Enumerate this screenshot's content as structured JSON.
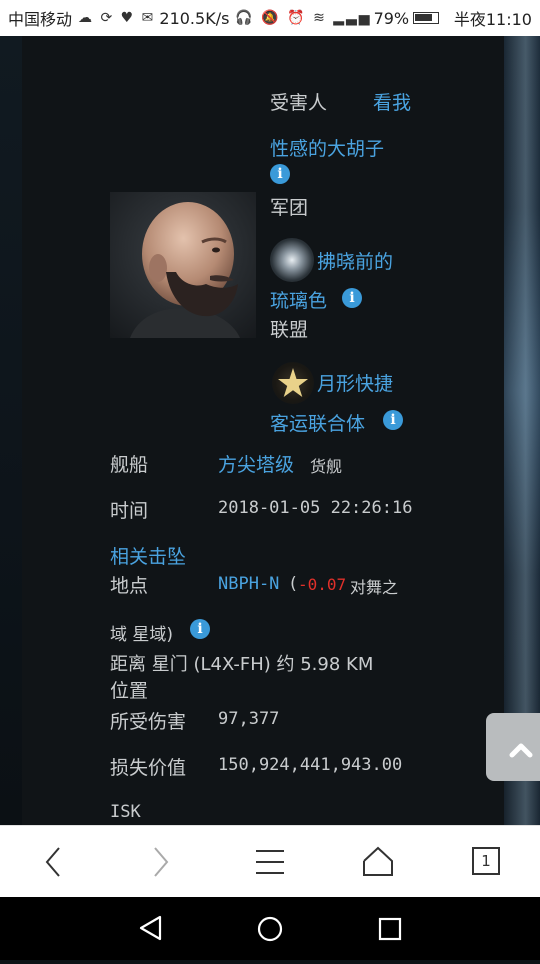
{
  "status_bar": {
    "carrier": "中国移动",
    "speed": "210.5K/s",
    "battery": "79%",
    "time": "半夜11:10",
    "icons": [
      "cloud-icon",
      "sync-icon",
      "heart-icon",
      "chat-icon",
      "headset-icon",
      "mute-icon",
      "alarm-icon",
      "wifi-icon",
      "4g-signal-icon",
      "battery-icon"
    ]
  },
  "victim": {
    "label": "受害人",
    "look_link": "看我",
    "name": "性感的大胡子",
    "corp_type": "军团",
    "corp_name_line1": "拂晓前的",
    "corp_name_line2": "琉璃色",
    "alliance_type": "联盟",
    "alliance_name_line1": "月形快捷",
    "alliance_name_line2": "客运联合体"
  },
  "details": {
    "ship_label": "舰船",
    "ship_name": "方尖塔级",
    "ship_class": "货舰",
    "time_label": "时间",
    "time_value": "2018-01-05 22:26:16",
    "related_kills": "相关击坠",
    "location_label": "地点",
    "system": "NBPH-N",
    "paren_open": "(",
    "security": "-0.07",
    "region_part1": "对舞之",
    "region_part2": "域 星域)",
    "distance_label": "距离 星门 (L4X-FH) 约 5.98 KM",
    "position_label": "位置",
    "damage_label": "所受伤害",
    "damage_value": "97,377",
    "loss_label": "损失价值",
    "loss_value": "150,924,441,943.00",
    "currency": "ISK"
  },
  "browser_nav": {
    "tab_count": "1"
  },
  "colors": {
    "link": "#4aa3e0",
    "security_negative": "#e0302a",
    "info_icon": "#3a9ad9"
  }
}
